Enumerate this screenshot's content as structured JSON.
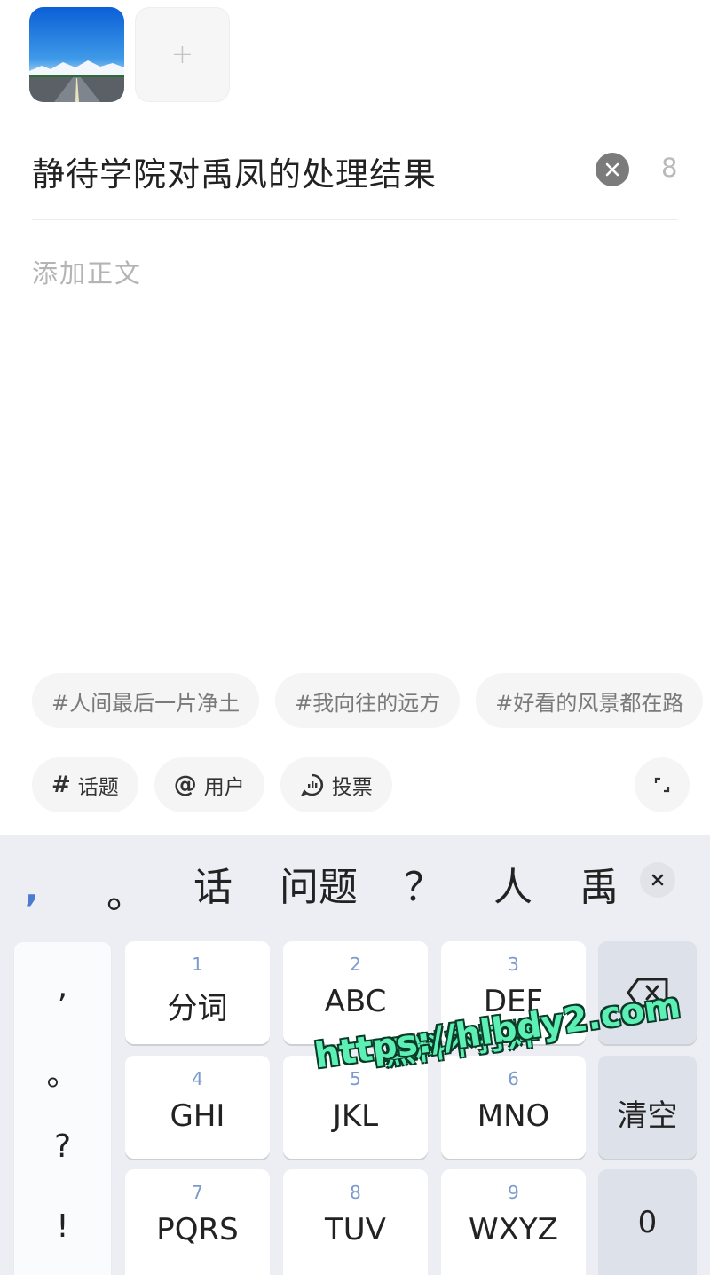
{
  "composer": {
    "add_photo_symbol": "+",
    "title": "静待学院对禹凤的处理结果",
    "title_char_count": "8",
    "body_placeholder": "添加正文"
  },
  "hashtag_suggestions": [
    "#人间最后一片净土",
    "#我向往的远方",
    "#好看的风景都在路"
  ],
  "tools": {
    "topic": {
      "icon": "#",
      "label": "话题"
    },
    "user": {
      "icon": "@",
      "label": "用户"
    },
    "vote": {
      "label": "投票"
    }
  },
  "keyboard": {
    "candidates": {
      "comma": ",",
      "period": "。",
      "c1": "话",
      "c2": "问题",
      "c3": "？",
      "c4": "人",
      "c5": "禹"
    },
    "punctuation": [
      ",",
      "。",
      "?",
      "!"
    ],
    "keys": {
      "k1": {
        "num": "1",
        "label": "分词"
      },
      "k2": {
        "num": "2",
        "label": "ABC"
      },
      "k3": {
        "num": "3",
        "label": "DEF"
      },
      "k4": {
        "num": "4",
        "label": "GHI"
      },
      "k5": {
        "num": "5",
        "label": "JKL"
      },
      "k6": {
        "num": "6",
        "label": "MNO"
      },
      "k7": {
        "num": "7",
        "label": "PQRS"
      },
      "k8": {
        "num": "8",
        "label": "TUV"
      },
      "k9": {
        "num": "9",
        "label": "WXYZ"
      },
      "clear": "清空",
      "zero": "0"
    }
  },
  "watermark": {
    "line1": "黑料不打烊",
    "line2": "https://hlbdy2.com"
  },
  "colors": {
    "accent_blue": "#4a7bd0",
    "keyboard_bg": "#eceef3",
    "watermark_green": "#5cf0b4"
  }
}
